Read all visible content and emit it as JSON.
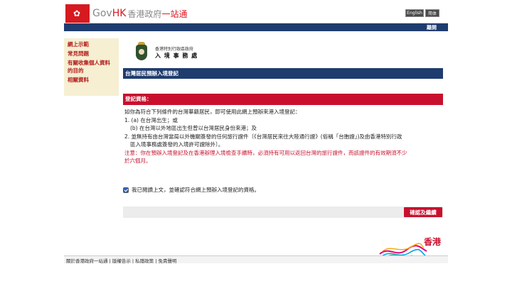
{
  "header": {
    "brand_gov": "Gov",
    "brand_hk": "HK",
    "brand_cn": "香港政府",
    "brand_cn_accent": "一站通",
    "lang_english": "English",
    "lang_simplified": "简体"
  },
  "topbar": {
    "exit": "離開"
  },
  "sidebar": {
    "items": [
      {
        "label": "網上示範"
      },
      {
        "label": "常見問題"
      },
      {
        "label": "有關收集個人資料的目的"
      },
      {
        "label": "相關資料"
      }
    ]
  },
  "dept": {
    "line1": "香港特別行政區政府",
    "line2": "入 境 事 務 處"
  },
  "page": {
    "title": "台灣居民預辦入境登記",
    "section_title": "登記資格：",
    "intro": "如你為符合下列條件的台灣華籍居民，即可使用此網上預辦來港入境登記：",
    "cond1a": "1. (a) 在台灣出生；或",
    "cond1b": "(b) 在台灣以外地區出生但曾以台灣居民身份來港；及",
    "cond2_l1": "2. 並無持有由台灣當局以外機關簽發的任何旅行證件〔《台灣居民來往大陸通行證》(俗稱「台胞證」)及由香港特別行政",
    "cond2_l2": "區入境事務處簽發的入境許可證除外〕。",
    "note_l1": "注意：你在預辦入境登記及在香港辦理入境檢查手續時，必須持有可用以返回台灣的旅行證件，而該證件的有效期須不少",
    "note_l2": "於六個月。",
    "agree_label": "我已閱讀上文，並確認符合網上預辦入境登記的資格。",
    "agree_checked": true,
    "confirm_button": "確認及繼續"
  },
  "footer": {
    "brand_hk": "香港",
    "links": "關於香港政府一站通 | 版權告示 | 私隱政策 | 免責聲明"
  }
}
